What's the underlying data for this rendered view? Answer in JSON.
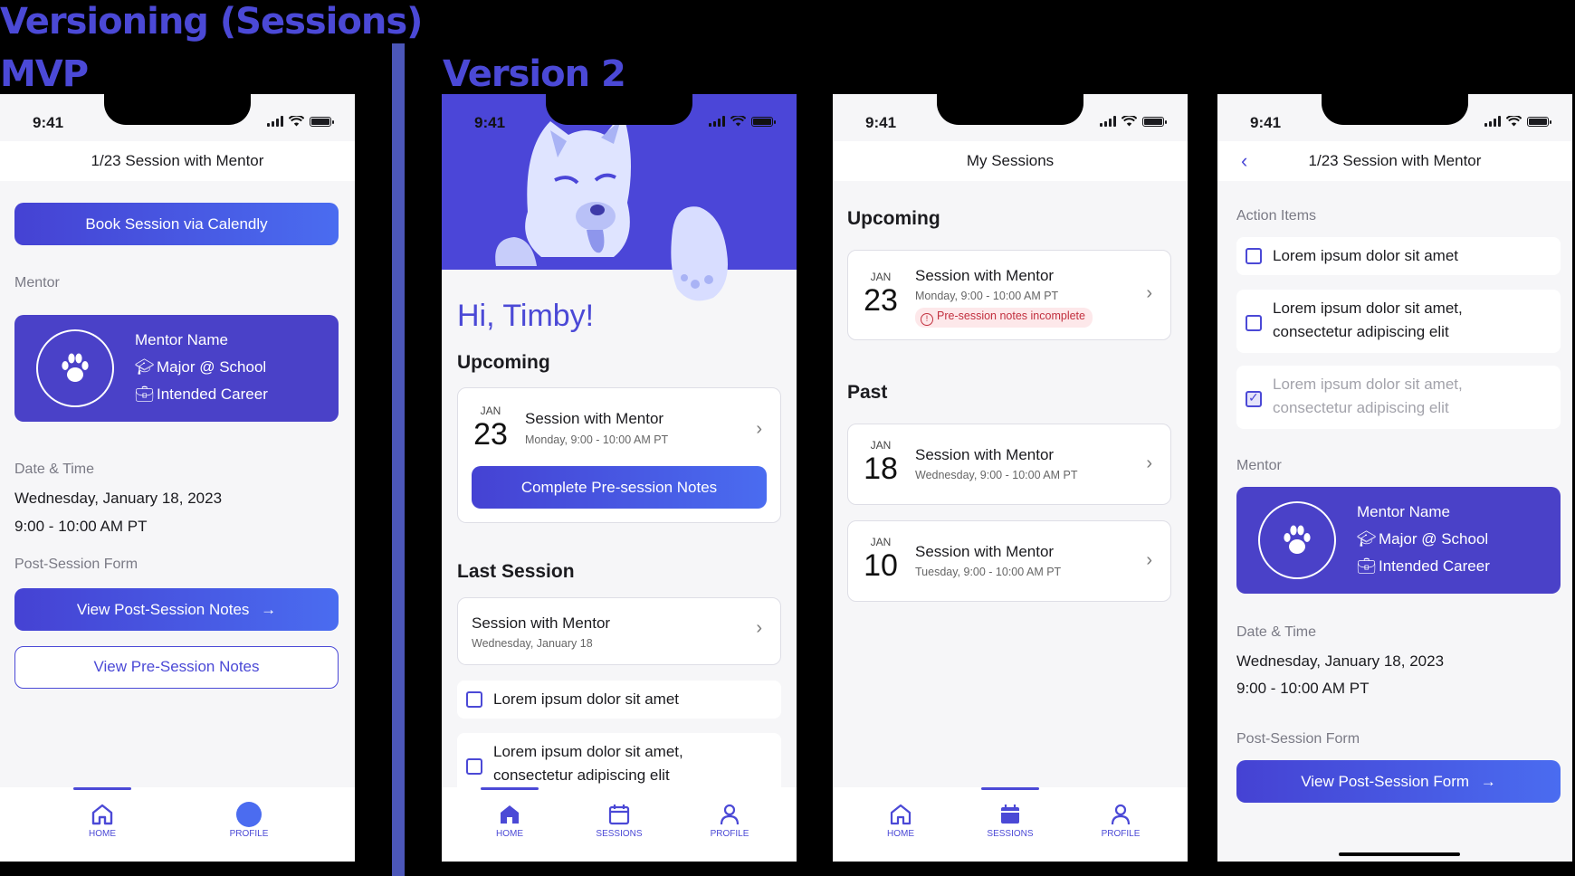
{
  "headings": {
    "main": "Versioning (Sessions)",
    "mvp": "MVP",
    "v2": "Version 2"
  },
  "status_time": "9:41",
  "mvp": {
    "title": "1/23 Session with Mentor",
    "book_button": "Book Session via Calendly",
    "mentor_label": "Mentor",
    "mentor_name": "Mentor Name",
    "mentor_major": "Major @ School",
    "mentor_career": "Intended Career",
    "date_label": "Date & Time",
    "date": "Wednesday, January 18, 2023",
    "time": "9:00 - 10:00 AM PT",
    "form_label": "Post-Session Form",
    "post_button": "View Post-Session Notes",
    "pre_button": "View Pre-Session Notes",
    "tabs": {
      "home": "HOME",
      "profile": "PROFILE"
    }
  },
  "v2_home": {
    "greeting": "Hi, Timby!",
    "upcoming": "Upcoming",
    "session_month": "JAN",
    "session_day": "23",
    "session_title": "Session with Mentor",
    "session_time": "Monday, 9:00 - 10:00 AM PT",
    "notes_button": "Complete Pre-session Notes",
    "last_session": "Last Session",
    "last_title": "Session with Mentor",
    "last_date": "Wednesday, January 18",
    "item1": "Lorem ipsum dolor sit amet",
    "item2": "Lorem ipsum dolor sit amet, consectetur adipiscing elit",
    "tabs": {
      "home": "HOME",
      "sessions": "SESSIONS",
      "profile": "PROFILE"
    }
  },
  "v2_sessions": {
    "title": "My Sessions",
    "upcoming": "Upcoming",
    "past": "Past",
    "sessions": [
      {
        "month": "JAN",
        "day": "23",
        "title": "Session with Mentor",
        "time": "Monday, 9:00 - 10:00 AM PT",
        "warning": "Pre-session notes incomplete"
      },
      {
        "month": "JAN",
        "day": "18",
        "title": "Session with Mentor",
        "time": "Wednesday, 9:00 - 10:00 AM PT"
      },
      {
        "month": "JAN",
        "day": "10",
        "title": "Session with Mentor",
        "time": "Tuesday, 9:00 - 10:00 AM PT"
      }
    ],
    "tabs": {
      "home": "HOME",
      "sessions": "SESSIONS",
      "profile": "PROFILE"
    }
  },
  "v2_detail": {
    "title": "1/23 Session with Mentor",
    "action_label": "Action Items",
    "items": [
      {
        "text": "Lorem ipsum dolor sit amet",
        "done": false
      },
      {
        "text": "Lorem ipsum dolor sit amet, consectetur adipiscing elit",
        "done": false
      },
      {
        "text": "Lorem ipsum dolor sit amet, consectetur adipiscing elit",
        "done": true
      }
    ],
    "mentor_label": "Mentor",
    "mentor_name": "Mentor Name",
    "mentor_major": "Major @ School",
    "mentor_career": "Intended Career",
    "date_label": "Date & Time",
    "date": "Wednesday, January 18, 2023",
    "time": "9:00 - 10:00 AM PT",
    "form_label": "Post-Session Form",
    "form_button": "View Post-Session Form"
  },
  "colors": {
    "brand": "#4b49d6",
    "card": "#4a41c8",
    "warning": "#c2303f"
  }
}
